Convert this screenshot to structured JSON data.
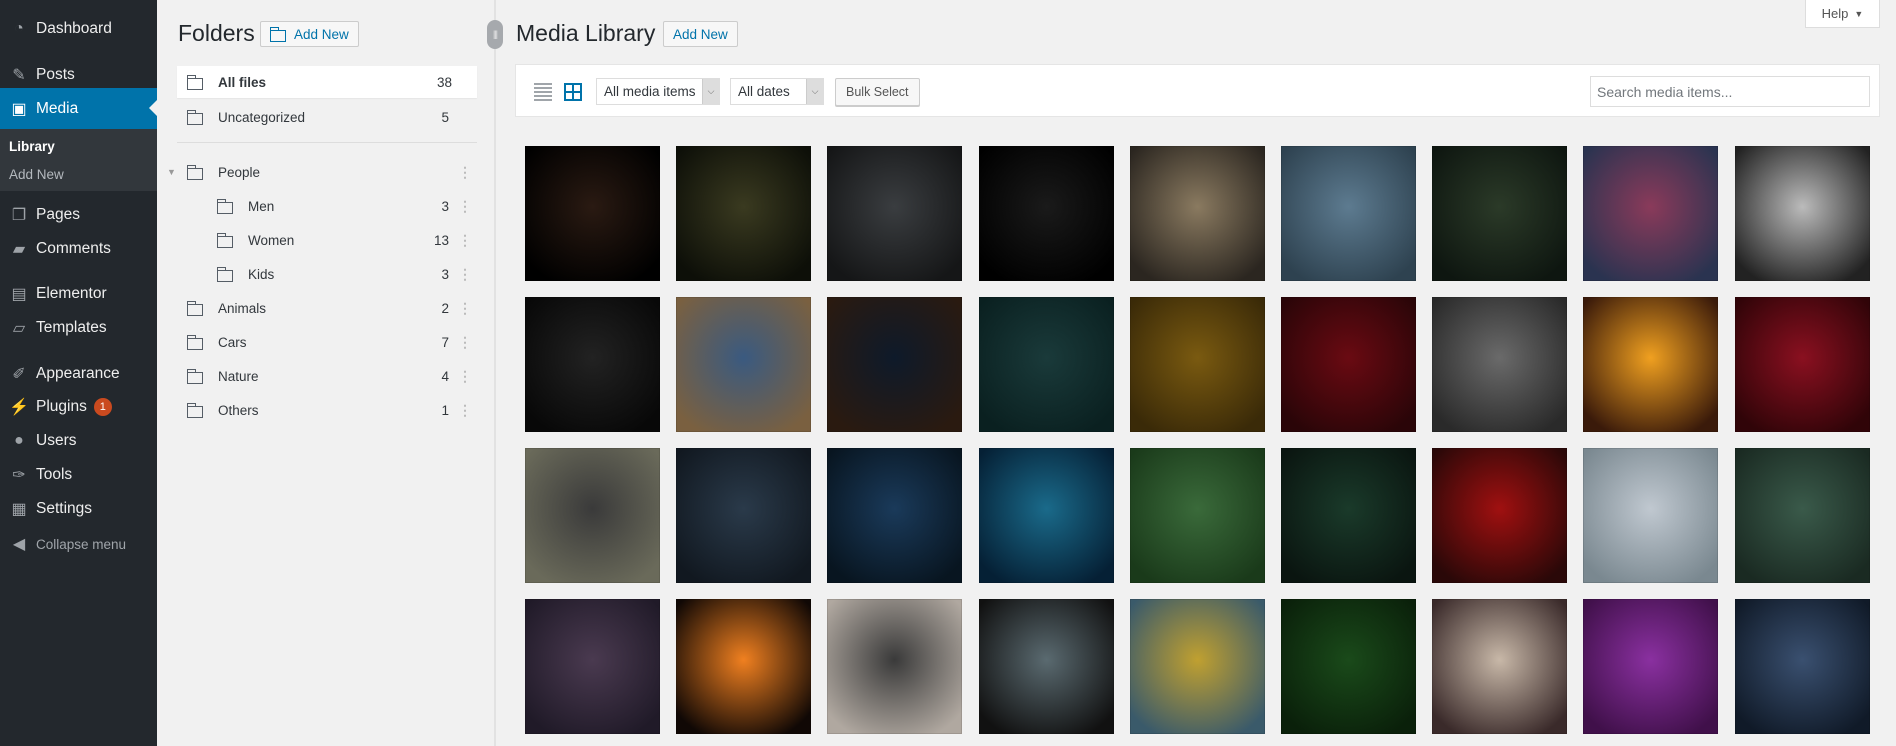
{
  "sidebar": {
    "items": [
      {
        "label": "Dashboard",
        "icon": "dashboard-icon",
        "glyph": "◔"
      },
      {
        "label": "Posts",
        "icon": "pin-icon",
        "glyph": "✎"
      },
      {
        "label": "Media",
        "icon": "media-icon",
        "glyph": "▣",
        "active": true
      },
      {
        "label": "Pages",
        "icon": "pages-icon",
        "glyph": "❐"
      },
      {
        "label": "Comments",
        "icon": "comment-icon",
        "glyph": "▰"
      },
      {
        "label": "Elementor",
        "icon": "elementor-icon",
        "glyph": "▤"
      },
      {
        "label": "Templates",
        "icon": "folder-open-icon",
        "glyph": "▱"
      },
      {
        "label": "Appearance",
        "icon": "brush-icon",
        "glyph": "✐"
      },
      {
        "label": "Plugins",
        "icon": "plugin-icon",
        "glyph": "⚡",
        "badge": "1"
      },
      {
        "label": "Users",
        "icon": "user-icon",
        "glyph": "●"
      },
      {
        "label": "Tools",
        "icon": "wrench-icon",
        "glyph": "✑"
      },
      {
        "label": "Settings",
        "icon": "settings-icon",
        "glyph": "▦"
      },
      {
        "label": "Collapse menu",
        "icon": "collapse-icon",
        "glyph": "◀",
        "collapse": true
      }
    ],
    "submenu": {
      "library": "Library",
      "add_new": "Add New"
    }
  },
  "folders": {
    "title": "Folders",
    "add_new": "Add New",
    "all_files": {
      "label": "All files",
      "count": "38"
    },
    "uncategorized": {
      "label": "Uncategorized",
      "count": "5"
    },
    "tree": [
      {
        "label": "People",
        "count": "",
        "level": 0,
        "caret": true
      },
      {
        "label": "Men",
        "count": "3",
        "level": 1
      },
      {
        "label": "Women",
        "count": "13",
        "level": 1
      },
      {
        "label": "Kids",
        "count": "3",
        "level": 1
      },
      {
        "label": "Animals",
        "count": "2",
        "level": 0
      },
      {
        "label": "Cars",
        "count": "7",
        "level": 0
      },
      {
        "label": "Nature",
        "count": "4",
        "level": 0
      },
      {
        "label": "Others",
        "count": "1",
        "level": 0
      }
    ]
  },
  "main": {
    "title": "Media Library",
    "add_new": "Add New",
    "help": "Help",
    "filter_type": "All media items",
    "filter_date": "All dates",
    "bulk_select": "Bulk Select",
    "search_placeholder": "Search media items..."
  },
  "thumbnails": [
    [
      "#2a1a12",
      "#000"
    ],
    [
      "#3a3a20",
      "#0d0f08"
    ],
    [
      "#3a3d40",
      "#151617"
    ],
    [
      "#1a1a1a",
      "#000"
    ],
    [
      "#8a7a60",
      "#2b2620"
    ],
    [
      "#5d7b90",
      "#2e4250"
    ],
    [
      "#2b3a28",
      "#0e1610"
    ],
    [
      "#8a3a5a",
      "#2a3350"
    ],
    [
      "#bbbbbb",
      "#222"
    ],
    [
      "#222",
      "#080808"
    ],
    [
      "#3a5a80",
      "#7a6040"
    ],
    [
      "#0e1a2a",
      "#2a1a10"
    ],
    [
      "#1a3a3a",
      "#0a2020"
    ],
    [
      "#7a5a10",
      "#3a2a08"
    ],
    [
      "#6a0a12",
      "#2a0508"
    ],
    [
      "#6a6a6a",
      "#2a2a2a"
    ],
    [
      "#f0a020",
      "#3a1a0a"
    ],
    [
      "#8a1020",
      "#300408"
    ],
    [
      "#3a3a3a",
      "#6a6a5a"
    ],
    [
      "#2a3a4a",
      "#111820"
    ],
    [
      "#1a3a5a",
      "#081520"
    ],
    [
      "#1a6a8a",
      "#052035"
    ],
    [
      "#3a6a3a",
      "#1a3a1a"
    ],
    [
      "#1a3a2a",
      "#0a1510"
    ],
    [
      "#a01010",
      "#2a0808"
    ],
    [
      "#c0c8d0",
      "#7a8890"
    ],
    [
      "#3a5a4a",
      "#1a2a22"
    ],
    [
      "#4a3a50",
      "#201a28"
    ],
    [
      "#f08020",
      "#100805"
    ],
    [
      "#3a3a3a",
      "#b0a8a0"
    ],
    [
      "#5a6a70",
      "#111"
    ],
    [
      "#c0a030",
      "#3a5a6a"
    ],
    [
      "#1a4a1a",
      "#0a200a"
    ],
    [
      "#c8b8a8",
      "#3a2a2a"
    ],
    [
      "#8a30a0",
      "#40104a"
    ],
    [
      "#3a5070",
      "#101a28"
    ]
  ]
}
